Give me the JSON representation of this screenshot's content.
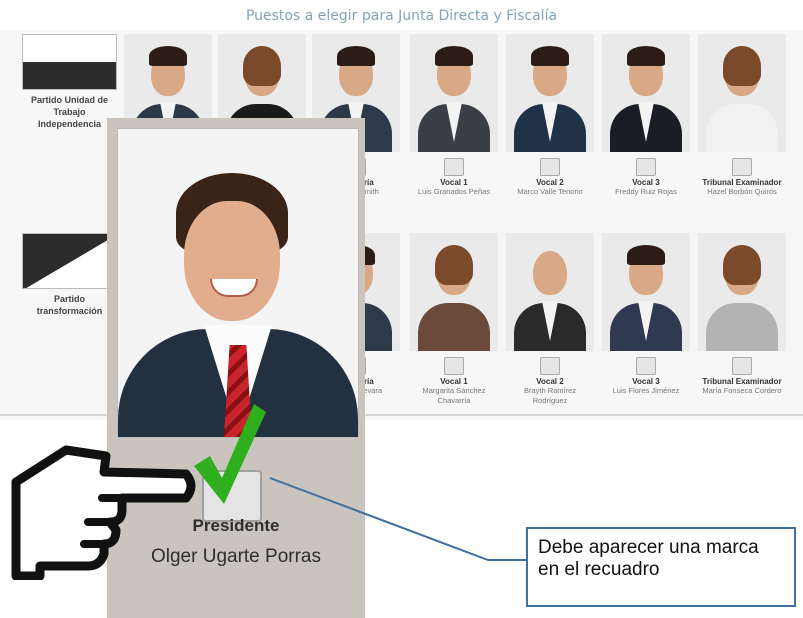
{
  "header": {
    "title": "Puestos a elegir para Junta Directa y Fiscalía"
  },
  "parties": [
    {
      "name": "Partido Unidad de Trabajo Independencia",
      "candidates": [
        {
          "position": "",
          "name": ""
        },
        {
          "position": "",
          "name": ""
        },
        {
          "position": "",
          "name": ""
        },
        {
          "position": "Tesorería",
          "name": "Warner Smith"
        },
        {
          "position": "Vocal 1",
          "name": "Luis Granados Peñas"
        },
        {
          "position": "Vocal 2",
          "name": "Marco Valle Tenorio"
        },
        {
          "position": "Vocal 3",
          "name": "Freddy Ruiz Rojas"
        },
        {
          "position": "Tribunal Examinador",
          "name": "Hazel Borbón Quirós"
        }
      ]
    },
    {
      "name": "Partido transformación",
      "candidates": [
        {
          "position": "Tesorería",
          "name": "Martín Guevara"
        },
        {
          "position": "Vocal 1",
          "name": "Margarita Sánchez Chavarría"
        },
        {
          "position": "Vocal 2",
          "name": "Brayth Ramírez Rodríguez"
        },
        {
          "position": "Vocal 3",
          "name": "Luis Flores Jiménez"
        },
        {
          "position": "Tribunal Examinador",
          "name": "María Fonseca Cordero"
        }
      ]
    }
  ],
  "popup": {
    "position": "Presidente",
    "name": "Olger Ugarte Porras",
    "checked": true
  },
  "annotation": {
    "text": "Debe aparecer una marca en el recuadro"
  },
  "icons": {
    "pointer": "pointing-hand-icon",
    "check": "green-checkmark-icon"
  },
  "colors": {
    "title": "#7fa3bb",
    "check": "#2fae1e",
    "callout_border": "#3f6fa3"
  }
}
